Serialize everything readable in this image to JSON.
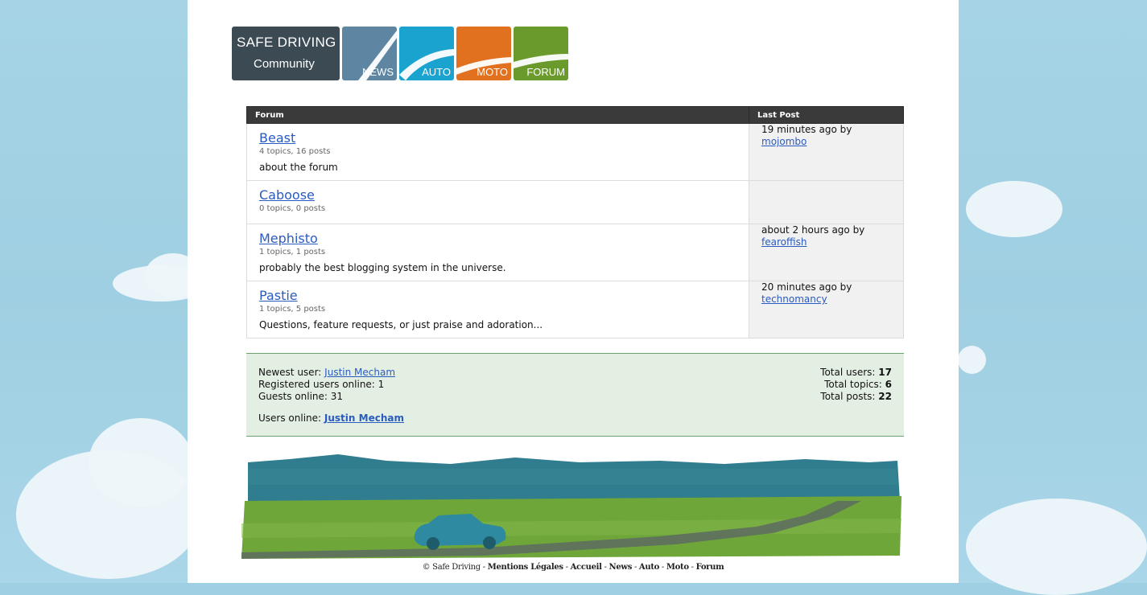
{
  "logo": {
    "line1": "SAFE DRIVING",
    "line2": "Community",
    "tiles": [
      {
        "label": "NEWS",
        "color": "#5e86a3"
      },
      {
        "label": "AUTO",
        "color": "#1aa3cf"
      },
      {
        "label": "MOTO",
        "color": "#e2711f"
      },
      {
        "label": "FORUM",
        "color": "#6b9a2c"
      }
    ]
  },
  "table": {
    "col_forum": "Forum",
    "col_last": "Last Post",
    "rows": [
      {
        "name": "Beast",
        "stats": "4 topics, 16 posts",
        "desc": "about the forum",
        "last_time": "19 minutes ago by",
        "last_user": "mojombo"
      },
      {
        "name": "Caboose",
        "stats": "0 topics, 0 posts",
        "desc": "",
        "last_time": "",
        "last_user": ""
      },
      {
        "name": "Mephisto",
        "stats": "1 topics, 1 posts",
        "desc": "probably the best blogging system in the universe.",
        "last_time": "about 2 hours ago by",
        "last_user": "fearoffish"
      },
      {
        "name": "Pastie",
        "stats": "1 topics, 5 posts",
        "desc": "Questions, feature requests, or just praise and adoration...",
        "last_time": "20 minutes ago by",
        "last_user": "technomancy"
      }
    ]
  },
  "stats": {
    "newest_label": "Newest user:",
    "newest_user": "Justin Mecham",
    "registered": "Registered users online: 1",
    "guests": "Guests online: 31",
    "online_label": "Users online:",
    "online_user": "Justin Mecham",
    "total_users_label": "Total users:",
    "total_users": "17",
    "total_topics_label": "Total topics:",
    "total_topics": "6",
    "total_posts_label": "Total posts:",
    "total_posts": "22"
  },
  "footer": {
    "copyright": "© Safe Driving",
    "links": [
      "Mentions Légales",
      "Accueil",
      "News",
      "Auto",
      "Moto",
      "Forum"
    ]
  }
}
